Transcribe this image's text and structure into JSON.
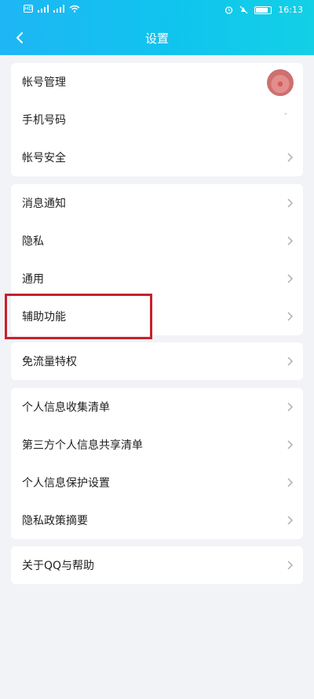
{
  "header": {
    "title": "设置",
    "status": {
      "sim1": "HD",
      "sim2": "HD",
      "battery": "100",
      "time": "16:13"
    }
  },
  "groups": [
    {
      "items": [
        {
          "label": "帐号管理",
          "key": "account-management"
        },
        {
          "label": "手机号码",
          "key": "phone-number"
        },
        {
          "label": "帐号安全",
          "key": "account-security"
        }
      ]
    },
    {
      "items": [
        {
          "label": "消息通知",
          "key": "message-notification"
        },
        {
          "label": "隐私",
          "key": "privacy"
        },
        {
          "label": "通用",
          "key": "general"
        },
        {
          "label": "辅助功能",
          "key": "accessibility"
        }
      ]
    },
    {
      "items": [
        {
          "label": "免流量特权",
          "key": "free-data"
        }
      ]
    },
    {
      "items": [
        {
          "label": "个人信息收集清单",
          "key": "personal-info-collection"
        },
        {
          "label": "第三方个人信息共享清单",
          "key": "third-party-sharing"
        },
        {
          "label": "个人信息保护设置",
          "key": "personal-info-protection"
        },
        {
          "label": "隐私政策摘要",
          "key": "privacy-policy-summary"
        }
      ]
    },
    {
      "items": [
        {
          "label": "关于QQ与帮助",
          "key": "about-help"
        }
      ]
    }
  ],
  "colors": {
    "accent_start": "#1eb6f5",
    "accent_end": "#13d0e6",
    "highlight": "#c9202a",
    "background": "#f2f3f7"
  },
  "icons": {
    "back": "back-arrow-icon",
    "chevron": "chevron-right-icon"
  }
}
